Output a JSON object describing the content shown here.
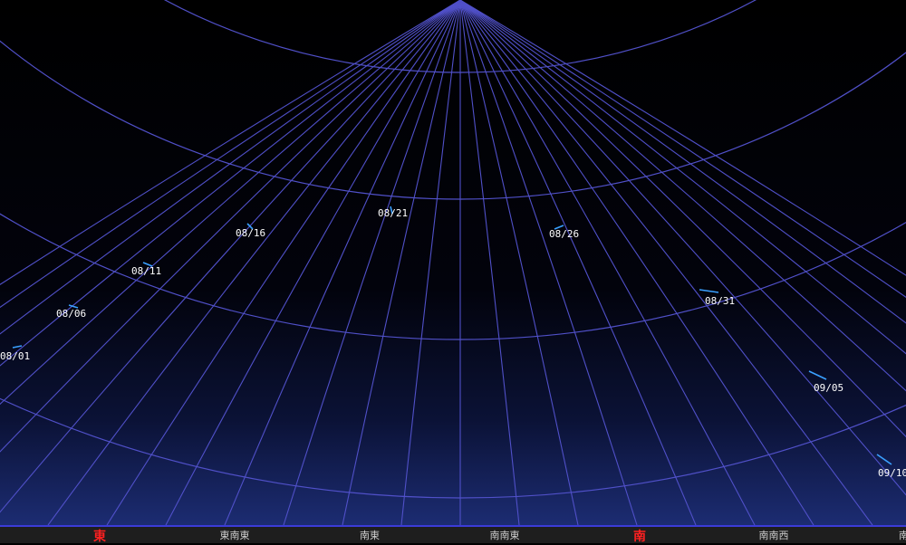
{
  "colors": {
    "grid": "#5050c8",
    "track": "#3aa0ff",
    "label": "#ffffff",
    "cardinal": "#ff2020",
    "sky_top": "#000000",
    "sky_bottom": "#1a2a6e"
  },
  "horizon": {
    "directions": [
      {
        "label": "東",
        "cardinal": true
      },
      {
        "label": "東南東",
        "cardinal": false
      },
      {
        "label": "南東",
        "cardinal": false
      },
      {
        "label": "南南東",
        "cardinal": false
      },
      {
        "label": "南",
        "cardinal": true
      },
      {
        "label": "南南西",
        "cardinal": false
      },
      {
        "label": "南西",
        "cardinal": false
      }
    ]
  },
  "comet_track": {
    "dates": [
      "08/01",
      "08/06",
      "08/11",
      "08/16",
      "08/21",
      "08/26",
      "08/31",
      "09/05",
      "09/10"
    ]
  }
}
